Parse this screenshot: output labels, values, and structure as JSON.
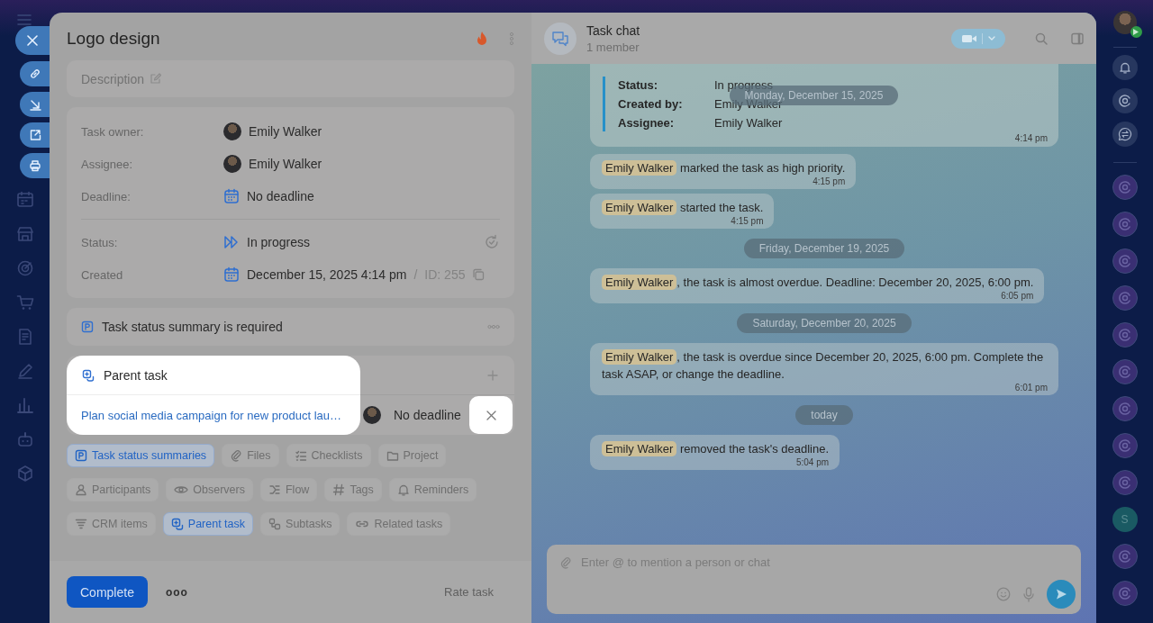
{
  "task": {
    "title": "Logo design",
    "description": {
      "placeholder": "Description"
    },
    "field_groups": [
      {
        "fields": [
          {
            "kind": "person",
            "label": "Task owner:",
            "value": "Emily Walker"
          },
          {
            "kind": "person",
            "label": "Assignee:",
            "value": "Emily Walker"
          },
          {
            "kind": "deadline",
            "label": "Deadline:",
            "value": "No deadline"
          }
        ]
      },
      {
        "fields": [
          {
            "kind": "status",
            "label": "Status:",
            "value": "In progress"
          },
          {
            "kind": "created",
            "label": "Created",
            "value": "December 15, 2025 4:14 pm",
            "separator": "/",
            "id": "ID: 255"
          }
        ]
      }
    ],
    "notice": "Task status summary is required",
    "parent_task": {
      "heading": "Parent task",
      "link": "Plan social media campaign for new product lau…",
      "deadline": "No deadline"
    },
    "chips": [
      {
        "label": "Task status summaries",
        "kind": "summary",
        "selected": true
      },
      {
        "label": "Files",
        "kind": "clip",
        "selected": false
      },
      {
        "label": "Checklists",
        "kind": "list",
        "selected": false
      },
      {
        "label": "Project",
        "kind": "folder",
        "selected": false
      },
      {
        "label": "Participants",
        "kind": "person",
        "selected": false
      },
      {
        "label": "Observers",
        "kind": "eye",
        "selected": false
      },
      {
        "label": "Flow",
        "kind": "flow",
        "selected": false
      },
      {
        "label": "Tags",
        "kind": "hash",
        "selected": false
      },
      {
        "label": "Reminders",
        "kind": "bell",
        "selected": false
      },
      {
        "label": "CRM items",
        "kind": "funnel",
        "selected": false
      },
      {
        "label": "Parent task",
        "kind": "parent",
        "selected": true
      },
      {
        "label": "Subtasks",
        "kind": "subtasks",
        "selected": false
      },
      {
        "label": "Related tasks",
        "kind": "link",
        "selected": false
      }
    ],
    "footer": {
      "complete": "Complete",
      "more": "ooo",
      "rate": "Rate task"
    }
  },
  "chat": {
    "title": "Task chat",
    "subtitle": "1 member",
    "card": {
      "fields": [
        {
          "label": "Status:",
          "value": "In progress"
        },
        {
          "label": "Created by:",
          "value": "Emily Walker"
        },
        {
          "label": "Assignee:",
          "value": "Emily Walker"
        }
      ],
      "time": "4:14 pm",
      "date": "Monday, December 15, 2025"
    },
    "messages": [
      {
        "kind": "message",
        "author": "Emily Walker",
        "text": "marked the task as high priority.",
        "time": "4:15 pm"
      },
      {
        "kind": "message",
        "author": "Emily Walker",
        "text": "started the task.",
        "time": "4:15 pm"
      },
      {
        "kind": "date",
        "text": "Friday, December 19, 2025"
      },
      {
        "kind": "message",
        "author": "Emily Walker",
        "text": ", the task is almost overdue. Deadline: December 20, 2025, 6:00 pm.",
        "time": "6:05 pm"
      },
      {
        "kind": "date",
        "text": "Saturday, December 20, 2025"
      },
      {
        "kind": "message",
        "author": "Emily Walker",
        "text": ", the task is overdue since December 20, 2025, 6:00 pm. Complete the task ASAP, or change the deadline.",
        "time": "6:01 pm"
      },
      {
        "kind": "date",
        "text": "today"
      },
      {
        "kind": "message",
        "author": "Emily Walker",
        "text": "removed the task's deadline.",
        "time": "5:04 pm"
      }
    ],
    "composer": {
      "placeholder": "Enter @ to mention a person or chat"
    }
  },
  "right_rail": {
    "items": [
      {
        "kind": "bot"
      },
      {
        "kind": "bot"
      },
      {
        "kind": "bot"
      },
      {
        "kind": "bot"
      },
      {
        "kind": "bot"
      },
      {
        "kind": "bot"
      },
      {
        "kind": "bot"
      },
      {
        "kind": "bot"
      },
      {
        "kind": "bot"
      },
      {
        "kind": "letter",
        "text": "S"
      },
      {
        "kind": "bot"
      },
      {
        "kind": "bot"
      }
    ]
  }
}
